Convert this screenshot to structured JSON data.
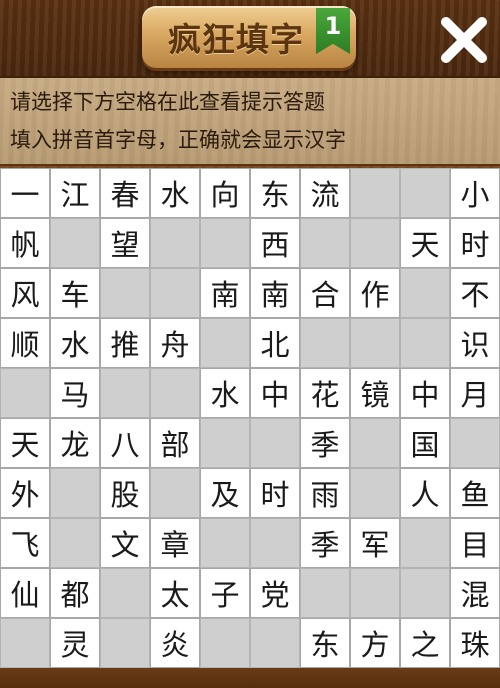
{
  "header": {
    "title": "疯狂填字",
    "level": "1",
    "close_icon": "close-icon"
  },
  "hints": {
    "line1": "请选择下方空格在此查看提示答题",
    "line2": "填入拼音首字母，正确就会显示汉字"
  },
  "colors": {
    "wood": "#6f3f1c",
    "hint_bg": "#c2a47b",
    "cell_open": "#ffffff",
    "cell_blocked": "#cfcfcf",
    "flag_green": "#2c7d25"
  },
  "grid": {
    "rows": [
      [
        "一",
        "江",
        "春",
        "水",
        "向",
        "东",
        "流",
        "#",
        "#",
        "小"
      ],
      [
        "帆",
        "#",
        "望",
        "#",
        "#",
        "西",
        "#",
        "#",
        "天",
        "时"
      ],
      [
        "风",
        "车",
        "#",
        "#",
        "南",
        "南",
        "合",
        "作",
        "#",
        "不"
      ],
      [
        "顺",
        "水",
        "推",
        "舟",
        "#",
        "北",
        "#",
        "#",
        "#",
        "识"
      ],
      [
        "#",
        "马",
        "#",
        "#",
        "水",
        "中",
        "花",
        "镜",
        "中",
        "月"
      ],
      [
        "天",
        "龙",
        "八",
        "部",
        "#",
        "#",
        "季",
        "#",
        "国",
        "#"
      ],
      [
        "外",
        "#",
        "股",
        "#",
        "及",
        "时",
        "雨",
        "#",
        "人",
        "鱼"
      ],
      [
        "飞",
        "#",
        "文",
        "章",
        "#",
        "#",
        "季",
        "军",
        "#",
        "目"
      ],
      [
        "仙",
        "都",
        "#",
        "太",
        "子",
        "党",
        "#",
        "#",
        "#",
        "混"
      ],
      [
        "#",
        "灵",
        "#",
        "炎",
        "#",
        "#",
        "东",
        "方",
        "之",
        "珠"
      ]
    ]
  }
}
